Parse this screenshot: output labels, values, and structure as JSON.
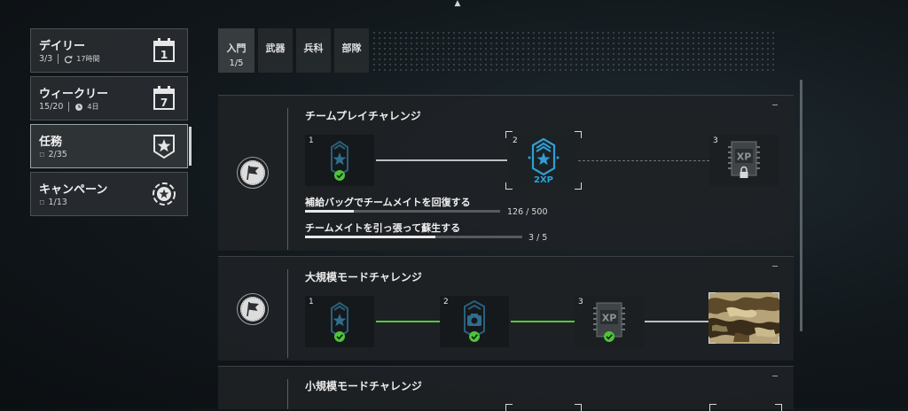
{
  "nav": {
    "items": [
      {
        "title": "デイリー",
        "progress": "3/3",
        "timer": "17時間",
        "icon_text": "1"
      },
      {
        "title": "ウィークリー",
        "progress": "15/20",
        "timer": "4日",
        "icon_text": "7"
      },
      {
        "title": "任務",
        "progress": "2/35",
        "active": true
      },
      {
        "title": "キャンペーン",
        "progress": "1/13"
      }
    ]
  },
  "tabs": [
    {
      "label": "入門",
      "count": "1/5",
      "active": true
    },
    {
      "label": "武器"
    },
    {
      "label": "兵科"
    },
    {
      "label": "部隊"
    }
  ],
  "panels": [
    {
      "title": "チームプレイチャレンジ",
      "tiles": [
        {
          "num": "1",
          "icon": "rank-chevron-star-icon",
          "status": "completed"
        },
        {
          "num": "2",
          "icon": "rank-chevron-2xp-icon",
          "badge": "2XP",
          "status": "selected"
        },
        {
          "num": "3",
          "icon": "xp-chip-locked-icon",
          "badge": "XP",
          "status": "locked"
        }
      ],
      "tasks": [
        {
          "label": "補給バッグでチームメイトを回復する",
          "value": "126 / 500",
          "fraction": 0.252
        },
        {
          "label": "チームメイトを引っ張って蘇生する",
          "value": "3 / 5",
          "fraction": 0.6
        }
      ]
    },
    {
      "title": "大規模モードチャレンジ",
      "tiles": [
        {
          "num": "1",
          "icon": "rank-chevron-star-icon",
          "status": "completed"
        },
        {
          "num": "2",
          "icon": "rank-chevron-camera-icon",
          "status": "completed"
        },
        {
          "num": "3",
          "icon": "xp-chip-icon",
          "badge": "XP",
          "status": "completed"
        },
        {
          "num": "",
          "icon": "camo-skin-icon",
          "status": "reward"
        }
      ]
    },
    {
      "title": "小規模モードチャレンジ"
    }
  ],
  "colors": {
    "accent_green": "#55c93a",
    "rank_blue": "#2f9fd6",
    "check_green": "#4fc43a"
  }
}
